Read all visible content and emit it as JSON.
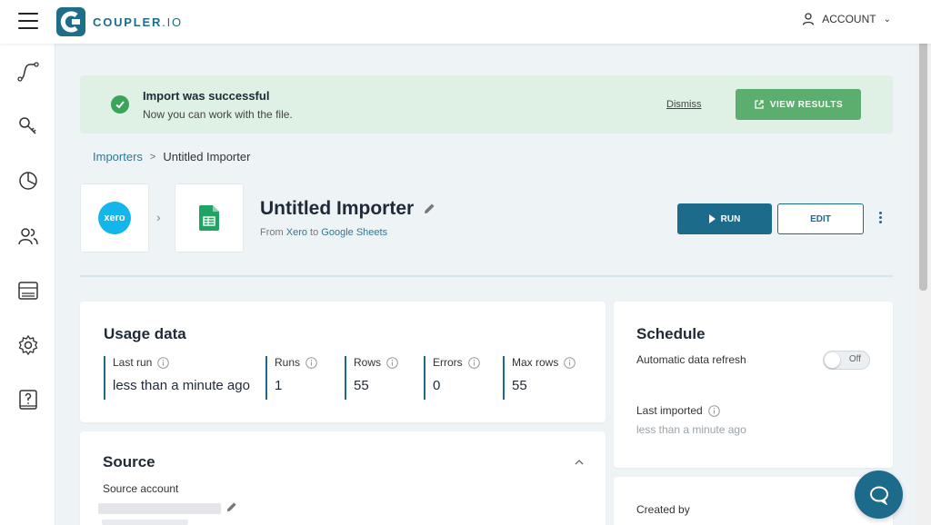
{
  "app": {
    "logo_text": "COUPLER",
    "logo_suffix": ".IO",
    "account_label": "ACCOUNT"
  },
  "sidebar": {
    "items": [
      {
        "name": "flows-icon"
      },
      {
        "name": "key-icon"
      },
      {
        "name": "chart-icon"
      },
      {
        "name": "users-icon"
      },
      {
        "name": "billing-icon"
      },
      {
        "name": "settings-icon"
      },
      {
        "name": "help-icon"
      }
    ]
  },
  "banner": {
    "title": "Import was successful",
    "subtitle": "Now you can work with the file.",
    "dismiss_label": "Dismiss",
    "view_results_label": "VIEW RESULTS"
  },
  "breadcrumb": {
    "parent": "Importers",
    "current": "Untitled Importer"
  },
  "importer": {
    "source_logo": "xero",
    "title": "Untitled Importer",
    "from_label": "From",
    "source": "Xero",
    "to_label": "to",
    "destination": "Google Sheets",
    "run_label": "RUN",
    "edit_label": "EDIT"
  },
  "usage": {
    "title": "Usage data",
    "stats": [
      {
        "label": "Last run",
        "value": "less than a minute ago"
      },
      {
        "label": "Runs",
        "value": "1"
      },
      {
        "label": "Rows",
        "value": "55"
      },
      {
        "label": "Errors",
        "value": "0"
      },
      {
        "label": "Max rows",
        "value": "55"
      }
    ]
  },
  "schedule": {
    "title": "Schedule",
    "auto_refresh_label": "Automatic data refresh",
    "toggle_state": "Off",
    "last_imported_label": "Last imported",
    "last_imported_value": "less than a minute ago"
  },
  "source": {
    "title": "Source",
    "account_label": "Source account"
  },
  "created": {
    "label": "Created by"
  },
  "colors": {
    "primary": "#1d6b8a",
    "success": "#5cae6f",
    "banner_bg": "#dff0e4",
    "xero": "#13b5ea",
    "sheets": "#1fa463"
  }
}
